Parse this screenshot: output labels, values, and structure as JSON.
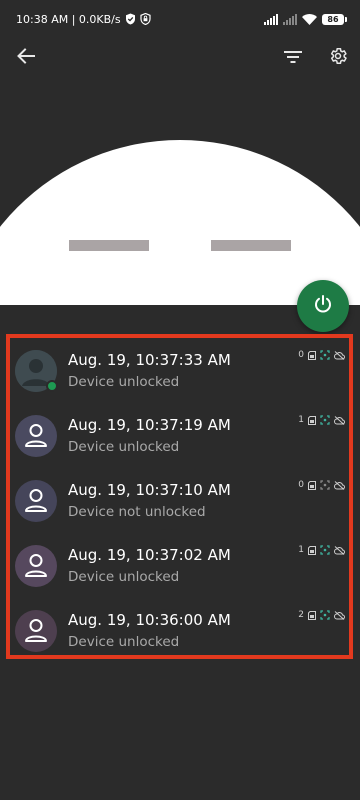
{
  "status_bar": {
    "time_speed": "10:38 AM | 0.0KB/s",
    "battery": "86",
    "icons": [
      "shield-check-icon",
      "lock-badge-icon",
      "signal-icon",
      "signal-icon",
      "wifi-icon",
      "battery-icon"
    ]
  },
  "toolbar": {
    "back_icon": "arrow-left-icon",
    "filter_icon": "filter-icon",
    "settings_icon": "gear-icon"
  },
  "power_button": {
    "icon": "power-icon",
    "color": "#1e7b45"
  },
  "colors": {
    "background": "#2b2b2b",
    "highlight_border": "#e2391e",
    "online_dot": "#1e9a52",
    "fingerprint_active": "#3fb4a0"
  },
  "events": [
    {
      "title": "Aug. 19, 10:37:33 AM",
      "subtitle": "Device unlocked",
      "count": "0",
      "avatar_style": "photo",
      "online": true,
      "fingerprint_active": true
    },
    {
      "title": "Aug. 19, 10:37:19 AM",
      "subtitle": "Device unlocked",
      "count": "1",
      "avatar_style": "default",
      "online": false,
      "fingerprint_active": true
    },
    {
      "title": "Aug. 19, 10:37:10 AM",
      "subtitle": "Device not unlocked",
      "count": "0",
      "avatar_style": "default",
      "online": false,
      "fingerprint_active": false
    },
    {
      "title": "Aug. 19, 10:37:02 AM",
      "subtitle": "Device unlocked",
      "count": "1",
      "avatar_style": "default",
      "online": false,
      "fingerprint_active": true
    },
    {
      "title": "Aug. 19, 10:36:00 AM",
      "subtitle": "Device unlocked",
      "count": "2",
      "avatar_style": "default",
      "online": false,
      "fingerprint_active": true
    }
  ]
}
